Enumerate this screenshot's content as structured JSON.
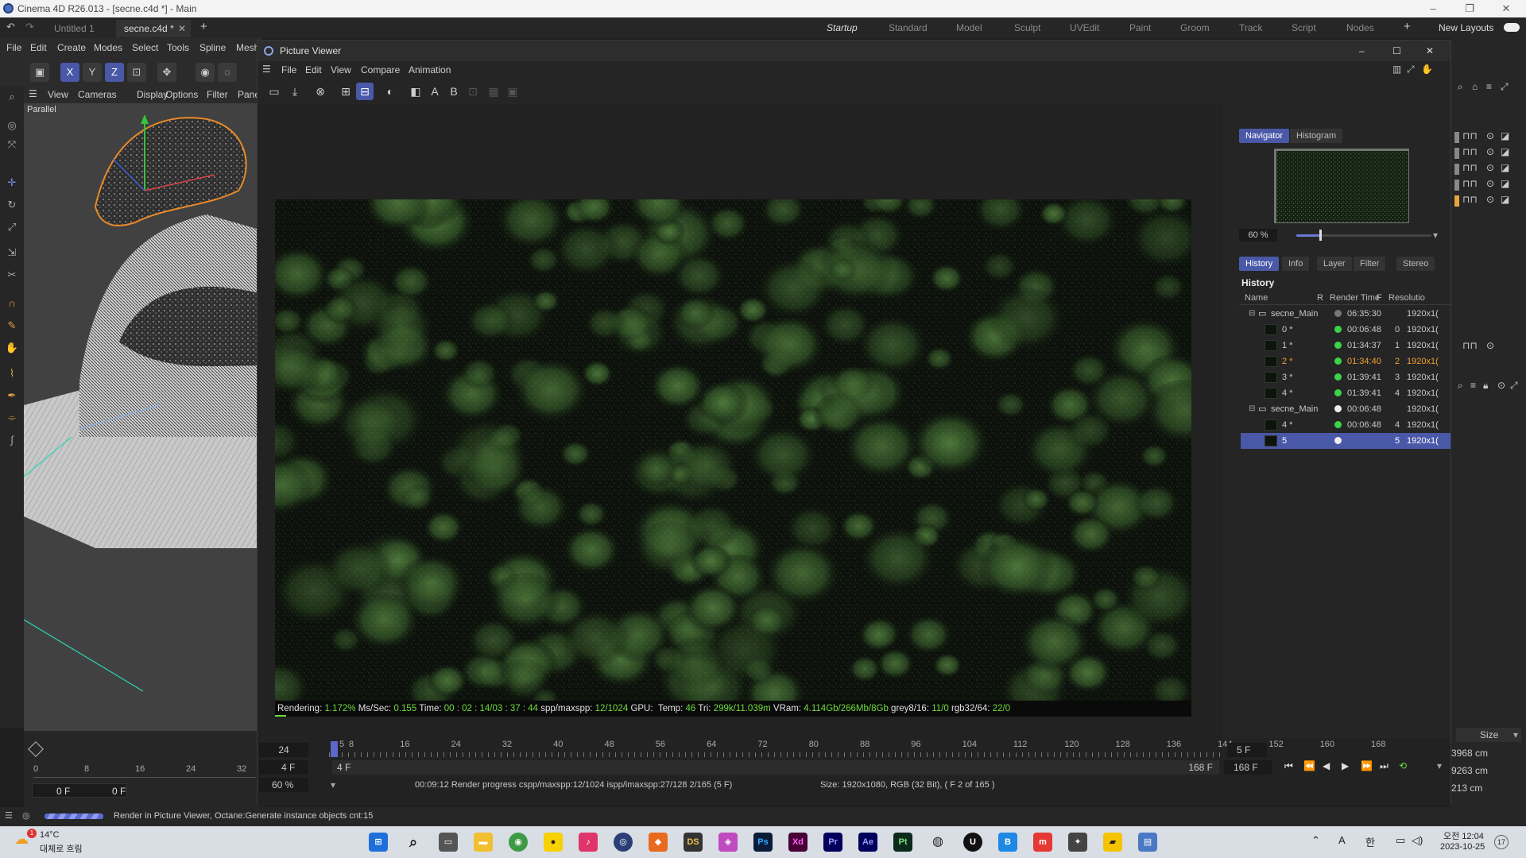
{
  "window": {
    "title": "Cinema 4D R26.013 - [secne.c4d *] - Main"
  },
  "tabs": [
    {
      "label": "Untitled 1"
    },
    {
      "label": "secne.c4d *"
    }
  ],
  "layouts": [
    "Startup",
    "Standard",
    "Model",
    "Sculpt",
    "UVEdit",
    "Paint",
    "Groom",
    "Track",
    "Script",
    "Nodes"
  ],
  "new_layouts_label": "New Layouts",
  "main_menu": [
    "File",
    "Edit",
    "Create",
    "Modes",
    "Select",
    "Tools",
    "Spline",
    "Mesh"
  ],
  "viewport": {
    "menu": [
      "View",
      "Cameras",
      "Display",
      "Options",
      "Filter",
      "Panel"
    ],
    "label": "Parallel",
    "frame_fields": [
      "0 F",
      "0 F"
    ],
    "ruler": [
      "0",
      "8",
      "16",
      "24",
      "32"
    ]
  },
  "picture_viewer": {
    "title": "Picture Viewer",
    "menu": [
      "File",
      "Edit",
      "View",
      "Compare",
      "Animation"
    ],
    "render_status": {
      "rendering_label": "Rendering:",
      "rendering": "1.172%",
      "mssec_label": "Ms/Sec:",
      "mssec": "0.155",
      "time_label": "Time:",
      "time": "00 : 02 : 14/03 : 37 : 44",
      "spp_label": "spp/maxspp:",
      "spp": "12/1024",
      "gpu_label": "GPU:",
      "temp_label": "Temp:",
      "temp": "46",
      "tri_label": "Tri:",
      "tri": "299k/11.039m",
      "vram_label": "VRam:",
      "vram": "4.114Gb/266Mb/8Gb",
      "grey_label": "grey8/16:",
      "grey": "11/0",
      "rgb_label": "rgb32/64:",
      "rgb": "22/0"
    },
    "panel_tabs_top": [
      "Navigator",
      "Histogram"
    ],
    "zoom": "60 %",
    "panel_tabs": [
      "History",
      "Info",
      "Layer",
      "Filter",
      "Stereo"
    ],
    "history_title": "History",
    "history_columns": [
      "Name",
      "R",
      "Render Time",
      "F",
      "Resolutio"
    ],
    "history_rows": [
      {
        "name": "secne_Main",
        "time": "06:35:30",
        "f": "",
        "res": "1920x1(",
        "kind": "group",
        "status": "grey"
      },
      {
        "name": "0 *",
        "time": "00:06:48",
        "f": "0",
        "res": "1920x1(",
        "kind": "item",
        "status": "green"
      },
      {
        "name": "1 *",
        "time": "01:34:37",
        "f": "1",
        "res": "1920x1(",
        "kind": "item",
        "status": "green"
      },
      {
        "name": "2 *",
        "time": "01:34:40",
        "f": "2",
        "res": "1920x1(",
        "kind": "item",
        "status": "green",
        "highlight": true
      },
      {
        "name": "3 *",
        "time": "01:39:41",
        "f": "3",
        "res": "1920x1(",
        "kind": "item",
        "status": "green"
      },
      {
        "name": "4 *",
        "time": "01:39:41",
        "f": "4",
        "res": "1920x1(",
        "kind": "item",
        "status": "green"
      },
      {
        "name": "secne_Main",
        "time": "00:06:48",
        "f": "",
        "res": "1920x1(",
        "kind": "group",
        "status": "white"
      },
      {
        "name": "4 *",
        "time": "00:06:48",
        "f": "4",
        "res": "1920x1(",
        "kind": "item",
        "status": "green"
      },
      {
        "name": "5",
        "time": "",
        "f": "5",
        "res": "1920x1(",
        "kind": "item",
        "status": "white",
        "selected": true
      }
    ],
    "timeline": {
      "fps": "24",
      "ticks": [
        "8",
        "16",
        "24",
        "32",
        "40",
        "48",
        "56",
        "64",
        "72",
        "80",
        "88",
        "96",
        "104",
        "112",
        "120",
        "128",
        "136",
        "144",
        "152",
        "160",
        "168"
      ],
      "marker": "5",
      "current_frame": "5 F",
      "start_field": "4 F",
      "range_start": "4 F",
      "range_end": "168 F",
      "end_field": "168 F",
      "zoom_field": "60 %",
      "progress_text": "00:09:12 Render progress  cspp/maxspp:12/1024  ispp/imaxspp:27/128 2/165 (5 F)",
      "size_text": "Size: 1920x1080, RGB (32 Bit),  ( F 2 of 165 )"
    }
  },
  "right_strip": {
    "size_label": "Size",
    "values": [
      "3968 cm",
      "9263 cm",
      "213 cm"
    ]
  },
  "status_bar": {
    "message": "Render in Picture Viewer, Octane:Generate instance objects cnt:15"
  },
  "taskbar": {
    "weather_temp": "14°C",
    "weather_desc": "대체로 흐림",
    "weather_badge": "1",
    "time": "오전 12:04",
    "date": "2023-10-25",
    "notif": "17",
    "ime_a": "A",
    "ime_han": "한",
    "apps": [
      "Ps",
      "Xd",
      "Pr",
      "Ae",
      "Pt",
      "DS",
      "B"
    ]
  }
}
